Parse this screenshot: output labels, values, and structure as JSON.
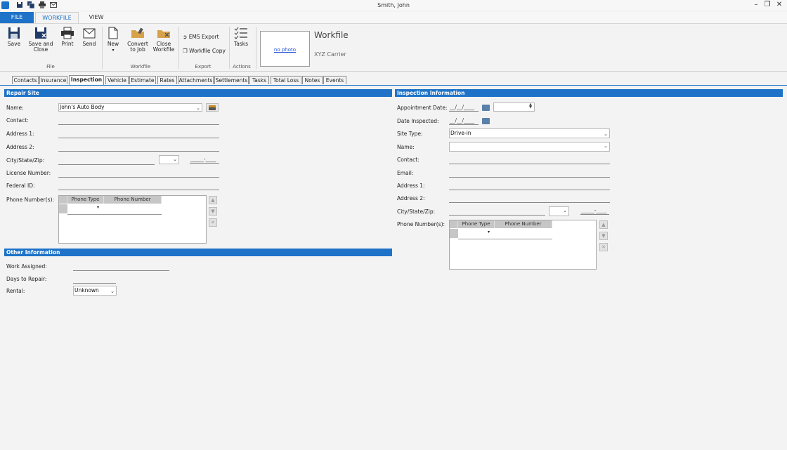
{
  "window": {
    "title": "Smith, John"
  },
  "ribbon_tabs": {
    "file": "FILE",
    "workfile": "WORKFILE",
    "view": "VIEW"
  },
  "ribbon": {
    "save": "Save",
    "save_close_1": "Save and",
    "save_close_2": "Close",
    "print": "Print",
    "send": "Send",
    "file_group": "File",
    "new": "New",
    "convert_1": "Convert",
    "convert_2": "to Job",
    "close_wf_1": "Close",
    "close_wf_2": "Workfile",
    "workfile_group": "Workfile",
    "ems_export": "EMS Export",
    "workfile_copy": "Workfile Copy",
    "export_group": "Export",
    "tasks": "Tasks",
    "actions_group": "Actions",
    "no_photo": "no photo",
    "workfile_title": "Workfile",
    "carrier": "XYZ Carrier"
  },
  "content_tabs": [
    "Contacts",
    "Insurance",
    "Inspection",
    "Vehicle",
    "Estimate",
    "Rates",
    "Attachments",
    "Settlements",
    "Tasks",
    "Total Loss",
    "Notes",
    "Events"
  ],
  "repair_site": {
    "header": "Repair Site",
    "name_label": "Name:",
    "name_value": "John's Auto Body",
    "contact_label": "Contact:",
    "address1_label": "Address 1:",
    "address2_label": "Address 2:",
    "csz_label": "City/State/Zip:",
    "zip_mask": "_____-____",
    "license_label": "License Number:",
    "federal_label": "Federal ID:",
    "phones_label": "Phone Number(s):",
    "phone_type_col": "Phone Type",
    "phone_number_col": "Phone Number"
  },
  "other_info": {
    "header": "Other Information",
    "work_assigned_label": "Work Assigned:",
    "days_repair_label": "Days to Repair:",
    "rental_label": "Rental:",
    "rental_value": "Unknown"
  },
  "inspection": {
    "header": "Inspection Information",
    "appt_label": "Appointment Date:",
    "date_mask": "__/__/____",
    "inspected_label": "Date Inspected:",
    "site_type_label": "Site Type:",
    "site_type_value": "Drive-in",
    "name_label": "Name:",
    "contact_label": "Contact:",
    "email_label": "Email:",
    "address1_label": "Address 1:",
    "address2_label": "Address 2:",
    "csz_label": "City/State/Zip:",
    "zip_mask": "_____-____",
    "phones_label": "Phone Number(s):",
    "phone_type_col": "Phone Type",
    "phone_number_col": "Phone Number"
  },
  "colors": {
    "accent": "#1e73c8",
    "header_bg": "#1e73c8"
  }
}
